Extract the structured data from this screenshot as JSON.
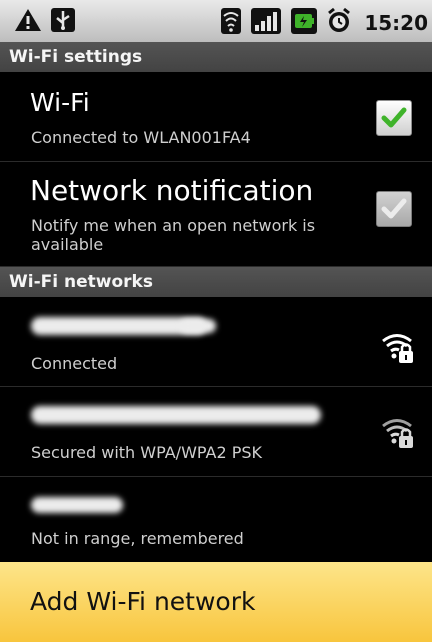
{
  "status_bar": {
    "icons": [
      "warning-icon",
      "usb-icon",
      "wifi-icon",
      "signal-icon",
      "battery-icon",
      "alarm-icon"
    ],
    "time": "15:20"
  },
  "wifi_settings": {
    "header": "Wi-Fi settings",
    "wifi": {
      "title": "Wi-Fi",
      "summary": "Connected to WLAN001FA4",
      "checked": true
    },
    "notification": {
      "title": "Network notification",
      "summary_line1": "Notify me when an open network is",
      "summary_line2": "available",
      "checked": true
    }
  },
  "wifi_networks": {
    "header": "Wi-Fi networks",
    "items": [
      {
        "status": "Connected",
        "icon": "wifi-lock-icon"
      },
      {
        "status": "Secured with WPA/WPA2 PSK",
        "icon": "wifi-lock-icon"
      },
      {
        "status": "Not in range, remembered"
      }
    ]
  },
  "add_network_label": "Add Wi-Fi network",
  "colors": {
    "accent_green": "#3fb32a",
    "button_yellow": "#f8c53d",
    "header_gray": "#4a4a4a"
  }
}
